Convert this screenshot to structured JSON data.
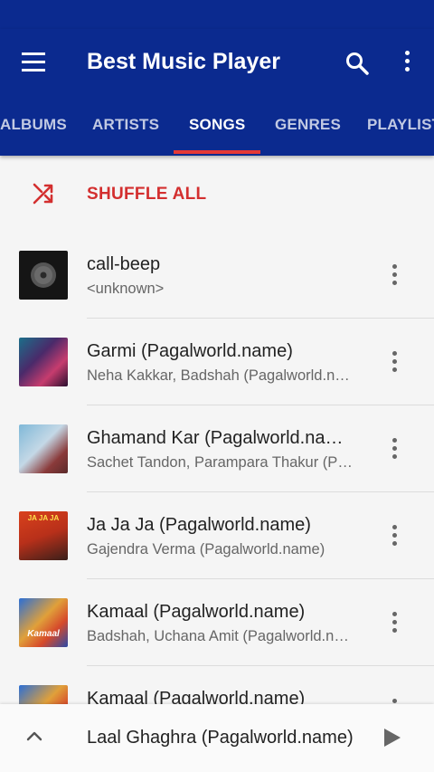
{
  "header": {
    "title": "Best Music Player",
    "bg_color": "#0b2a8f",
    "accent_color": "#e53935"
  },
  "tabs": [
    {
      "label": "ALBUMS",
      "active": false
    },
    {
      "label": "ARTISTS",
      "active": false
    },
    {
      "label": "SONGS",
      "active": true
    },
    {
      "label": "GENRES",
      "active": false
    },
    {
      "label": "PLAYLISTS",
      "active": false
    }
  ],
  "shuffle": {
    "label": "SHUFFLE ALL",
    "icon": "shuffle-icon"
  },
  "songs": [
    {
      "title": "call-beep",
      "artist": "<unknown>",
      "art": "disc"
    },
    {
      "title": "Garmi (Pagalworld.name)",
      "artist": "Neha Kakkar, Badshah (Pagalworld.name)",
      "art": "garmi"
    },
    {
      "title": "Ghamand Kar (Pagalworld.name)",
      "artist": "Sachet Tandon, Parampara Thakur (Pagalworld.name)",
      "art": "ghamand"
    },
    {
      "title": "Ja Ja Ja (Pagalworld.name)",
      "artist": "Gajendra Verma (Pagalworld.name)",
      "art": "jajaja",
      "art_text": "JA JA JA"
    },
    {
      "title": "Kamaal (Pagalworld.name)",
      "artist": "Badshah, Uchana Amit (Pagalworld.name)",
      "art": "kamaal",
      "art_text": "Kamaal"
    },
    {
      "title": "Kamaal (Pagalworld.name)",
      "artist": "",
      "art": "kamaal"
    }
  ],
  "now_playing": {
    "title": "Laal Ghaghra (Pagalworld.name)",
    "icon": "play-icon"
  }
}
